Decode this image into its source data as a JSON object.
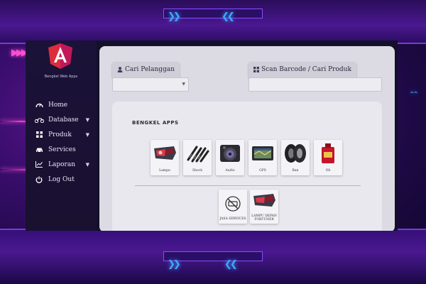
{
  "sidebar": {
    "brand": "Bengkel Web Apps",
    "items": [
      {
        "label": "Home",
        "icon": "dashboard-icon",
        "has_arrow": false
      },
      {
        "label": "Database",
        "icon": "motorbike-icon",
        "has_arrow": true
      },
      {
        "label": "Produk",
        "icon": "grid-icon",
        "has_arrow": true
      },
      {
        "label": "Services",
        "icon": "car-icon",
        "has_arrow": false
      },
      {
        "label": "Laporan",
        "icon": "chart-icon",
        "has_arrow": true
      },
      {
        "label": "Log Out",
        "icon": "power-icon",
        "has_arrow": false
      }
    ]
  },
  "search": {
    "customer_label": "Cari Pelanggan",
    "customer_value": "",
    "product_label": "Scan Barcode / Cari Produk",
    "product_placeholder": ""
  },
  "panel": {
    "title": "BENGKEL APPS",
    "products": [
      {
        "label": "Lampu",
        "icon": "car-lamp-icon"
      },
      {
        "label": "Shock",
        "icon": "shock-absorber-icon"
      },
      {
        "label": "Audio",
        "icon": "speaker-icon"
      },
      {
        "label": "GPS",
        "icon": "gps-icon"
      },
      {
        "label": "Ban",
        "icon": "tire-icon"
      },
      {
        "label": "Oli",
        "icon": "oil-icon"
      }
    ],
    "services": [
      {
        "label": "JASA SERVICES",
        "icon": "service-icon"
      },
      {
        "label": "LAMPU DEPAN FORTUNER",
        "icon": "car-lamp-icon"
      }
    ]
  },
  "colors": {
    "accent_red": "#dd2c3c",
    "sidebar_bg": "#1a1238",
    "content_bg": "#dcdbe4",
    "frame_purple": "#4a1890"
  }
}
